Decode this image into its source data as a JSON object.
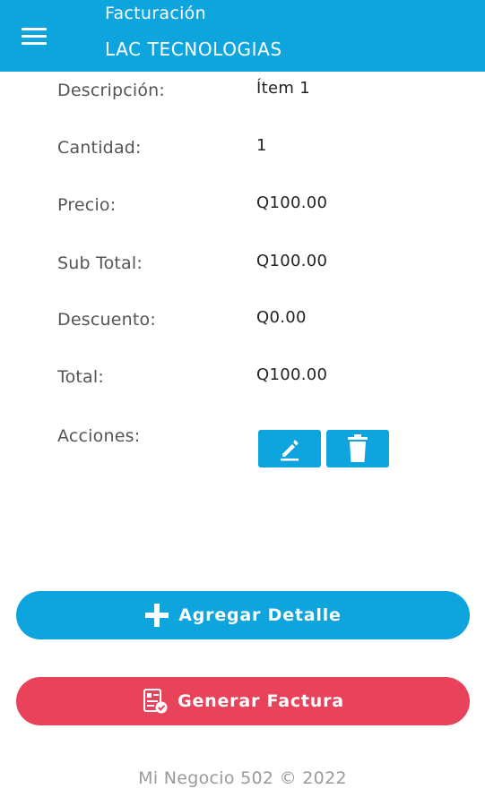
{
  "header": {
    "title": "Facturación",
    "subtitle": "LAC TECNOLOGIAS",
    "background": "#0ea4dd",
    "menu_icon": "hamburger-menu-icon"
  },
  "detail": {
    "rows": [
      {
        "label": "Descripción:",
        "value": "Ítem 1"
      },
      {
        "label": "Cantidad:",
        "value": "1"
      },
      {
        "label": "Precio:",
        "value": "Q100.00"
      },
      {
        "label": "Sub Total:",
        "value": "Q100.00"
      },
      {
        "label": "Descuento:",
        "value": "Q0.00"
      },
      {
        "label": "Total:",
        "value": "Q100.00"
      }
    ],
    "actions_label": "Acciones:",
    "edit_icon": "pencil-icon",
    "delete_icon": "trash-icon"
  },
  "buttons": {
    "add_detail": {
      "label": "Agregar Detalle",
      "icon": "plus-icon",
      "color": "#0ea4dd"
    },
    "generate_invoice": {
      "label": "Generar Factura",
      "icon": "invoice-check-icon",
      "color": "#e8435b"
    }
  },
  "footer": {
    "text": "Mi Negocio 502 © 2022"
  }
}
